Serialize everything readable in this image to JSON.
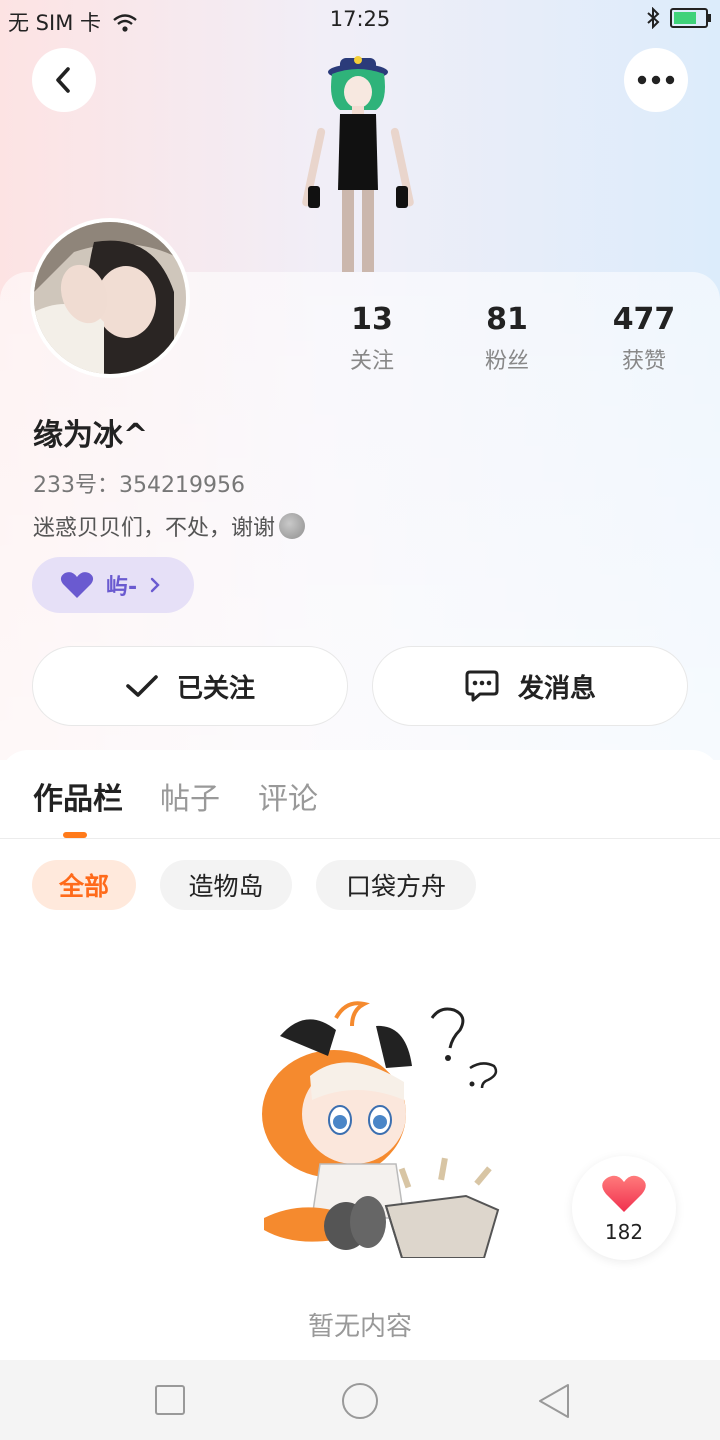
{
  "status_bar": {
    "carrier": "无 SIM 卡",
    "time": "17:25"
  },
  "profile": {
    "stats": [
      {
        "value": "13",
        "label": "关注"
      },
      {
        "value": "81",
        "label": "粉丝"
      },
      {
        "value": "477",
        "label": "获赞"
      }
    ],
    "name": "缘为冰^",
    "uid": "233号：354219956",
    "bio": "迷惑贝贝们，不处，谢谢",
    "tag_label": "屿-"
  },
  "actions": {
    "follow_label": "已关注",
    "message_label": "发消息"
  },
  "tabs": [
    {
      "label": "作品栏",
      "active": true
    },
    {
      "label": "帖子",
      "active": false
    },
    {
      "label": "评论",
      "active": false
    }
  ],
  "filters": [
    {
      "label": "全部",
      "active": true
    },
    {
      "label": "造物岛",
      "active": false
    },
    {
      "label": "口袋方舟",
      "active": false
    }
  ],
  "empty_state": {
    "text": "暂无内容"
  },
  "like_button": {
    "count": "182"
  },
  "colors": {
    "accent": "#ff7a1a",
    "tag_bg": "#e6e0f7",
    "tag_text": "#6a5ad0"
  }
}
